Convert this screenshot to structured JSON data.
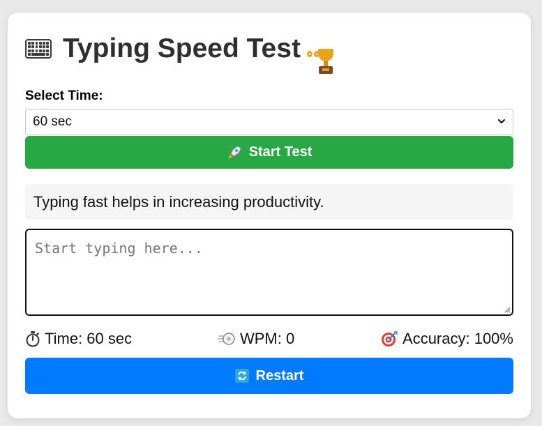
{
  "app": {
    "title": "Typing Speed Test",
    "title_icon_left": "keyboard-icon",
    "title_icon_right": "trophy-icon"
  },
  "time_select": {
    "label": "Select Time:",
    "selected": "60 sec"
  },
  "start_button": {
    "icon": "rocket-icon",
    "label": "Start Test",
    "color": "#28a745"
  },
  "quote": {
    "text": "Typing fast helps in increasing productivity."
  },
  "typing_area": {
    "value": "",
    "placeholder": "Start typing here..."
  },
  "stats": {
    "time": {
      "icon": "stopwatch-icon",
      "text": "Time: 60 sec"
    },
    "wpm": {
      "icon": "speed-icon",
      "text": "WPM: 0"
    },
    "accuracy": {
      "icon": "target-icon",
      "text": "Accuracy: 100%"
    }
  },
  "restart_button": {
    "icon": "refresh-icon",
    "label": "Restart",
    "color": "#007bff"
  }
}
